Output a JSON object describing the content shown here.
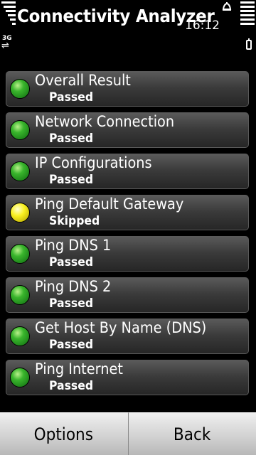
{
  "status_bar": {
    "network_type": "3G",
    "time": "16:12"
  },
  "app": {
    "title": "Connectivity Analyzer"
  },
  "results": [
    {
      "name": "Overall Result",
      "status": "Passed",
      "indicator": "green"
    },
    {
      "name": "Network Connection",
      "status": "Passed",
      "indicator": "green"
    },
    {
      "name": "IP Configurations",
      "status": "Passed",
      "indicator": "green"
    },
    {
      "name": "Ping Default Gateway",
      "status": "Skipped",
      "indicator": "yellow"
    },
    {
      "name": "Ping DNS 1",
      "status": "Passed",
      "indicator": "green"
    },
    {
      "name": "Ping DNS 2",
      "status": "Passed",
      "indicator": "green"
    },
    {
      "name": "Get Host By Name (DNS)",
      "status": "Passed",
      "indicator": "green"
    },
    {
      "name": "Ping Internet",
      "status": "Passed",
      "indicator": "green"
    }
  ],
  "softkeys": {
    "left": "Options",
    "right": "Back"
  },
  "colors": {
    "passed": "#39b52c",
    "skipped": "#f8f020"
  }
}
